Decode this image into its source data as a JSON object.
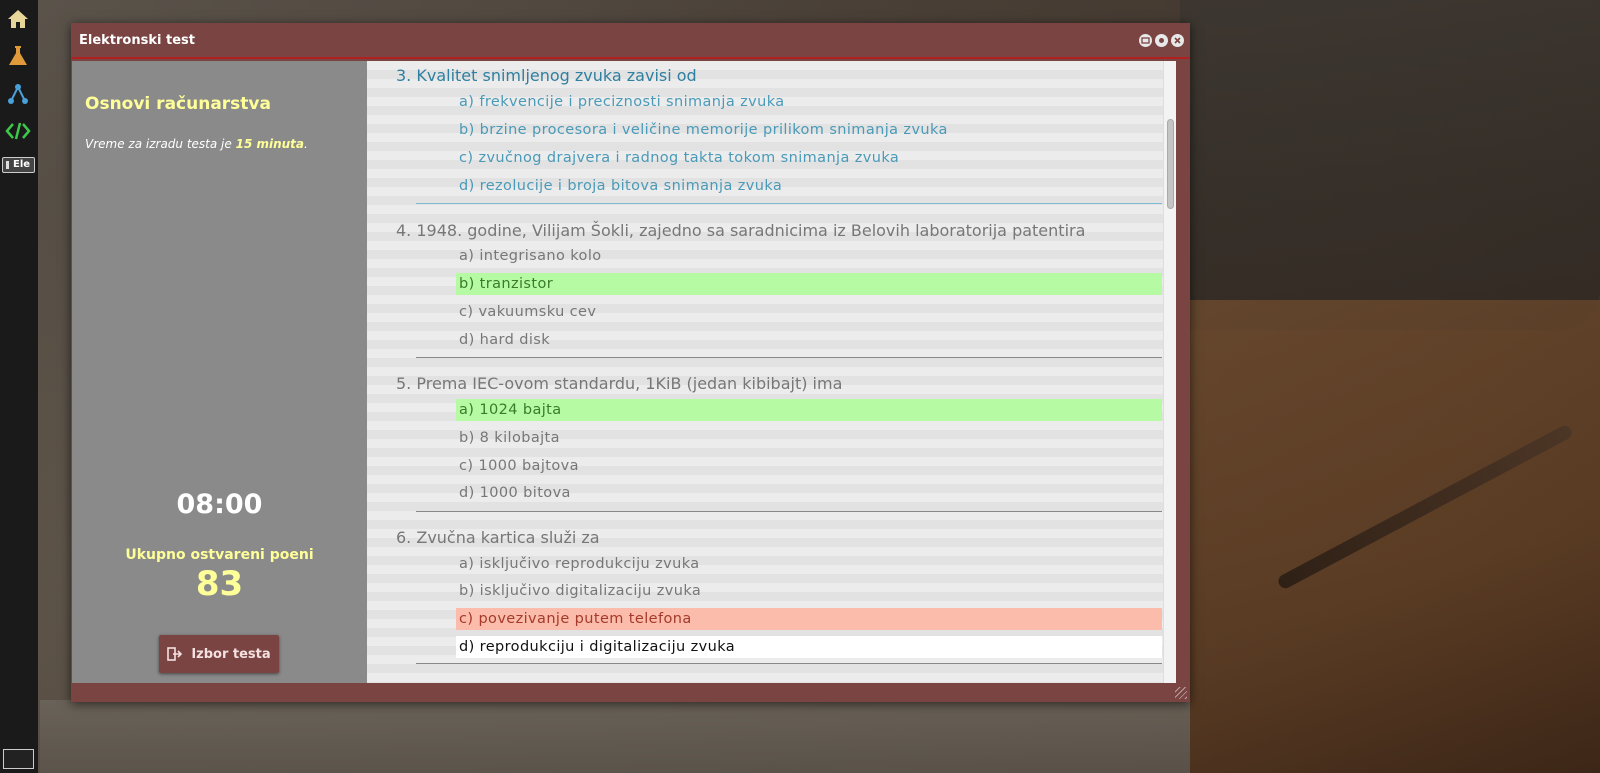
{
  "window": {
    "title": "Elektronski test"
  },
  "dock": {
    "label": "Ele"
  },
  "sidebar": {
    "course_title": "Osnovi računarstva",
    "time_note_prefix": "Vreme za izradu testa je ",
    "time_note_value": "15 minuta",
    "time_note_suffix": ".",
    "timer": "08:00",
    "points_label": "Ukupno ostvareni poeni",
    "points_value": "83",
    "back_button_label": "Izbor testa"
  },
  "questions": [
    {
      "title": "3. Kvalitet snimljenog zvuka zavisi od",
      "state": "active",
      "answers": [
        {
          "text": "a) frekvencije i preciznosti snimanja zvuka",
          "status": "none"
        },
        {
          "text": "b) brzine procesora i veličine memorije prilikom snimanja zvuka",
          "status": "none"
        },
        {
          "text": "c) zvučnog drajvera i radnog takta tokom snimanja zvuka",
          "status": "none"
        },
        {
          "text": "d) rezolucije i broja bitova snimanja zvuka",
          "status": "none"
        }
      ]
    },
    {
      "title": "4. 1948. godine, Vilijam Šokli, zajedno sa saradnicima iz Belovih laboratorija patentira",
      "state": "answered",
      "answers": [
        {
          "text": "a) integrisano kolo",
          "status": "none"
        },
        {
          "text": "b) tranzistor",
          "status": "correct"
        },
        {
          "text": "c) vakuumsku cev",
          "status": "none"
        },
        {
          "text": "d) hard disk",
          "status": "none"
        }
      ]
    },
    {
      "title": "5. Prema IEC-ovom standardu, 1KiB (jedan kibibajt) ima",
      "state": "answered",
      "answers": [
        {
          "text": "a) 1024 bajta",
          "status": "correct"
        },
        {
          "text": "b) 8 kilobajta",
          "status": "none"
        },
        {
          "text": "c) 1000 bajtova",
          "status": "none"
        },
        {
          "text": "d) 1000 bitova",
          "status": "none"
        }
      ]
    },
    {
      "title": "6. Zvučna kartica služi za",
      "state": "answered",
      "answers": [
        {
          "text": "a) isključivo reprodukciju zvuka",
          "status": "none"
        },
        {
          "text": "b) isključivo digitalizaciju zvuka",
          "status": "none"
        },
        {
          "text": "c) povezivanje putem telefona",
          "status": "wrong"
        },
        {
          "text": "d) reprodukciju i digitalizaciju zvuka",
          "status": "selected"
        }
      ]
    }
  ],
  "colors": {
    "window_frame": "#7a4443",
    "sidebar_bg": "#8a8a8a",
    "accent_yellow": "#ffff99",
    "active_question": "#2f7fa0",
    "correct_bg": "#b6fba4",
    "wrong_bg": "#fbbcab"
  },
  "icons": [
    "home-icon",
    "flask-icon",
    "network-icon",
    "code-icon",
    "minimize-icon",
    "maximize-icon",
    "close-icon",
    "exit-icon"
  ]
}
